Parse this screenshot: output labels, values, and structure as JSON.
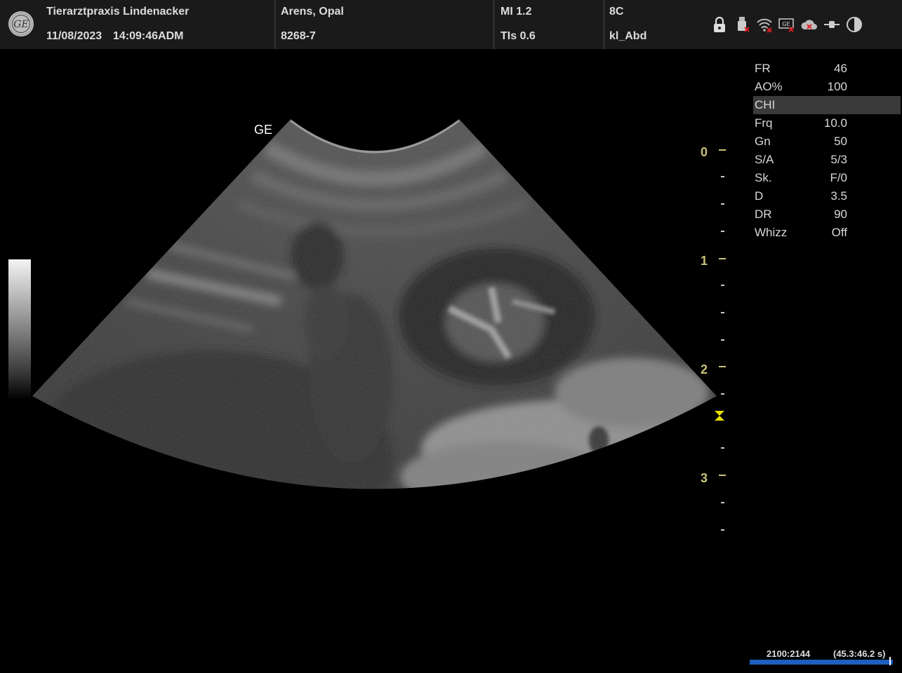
{
  "header": {
    "institution": "Tierarztpraxis Lindenacker",
    "date": "11/08/2023",
    "time": "14:09:46ADM",
    "patient_name": "Arens, Opal",
    "patient_id": "8268-7",
    "mi": "MI 1.2",
    "tis": "TIs 0.6",
    "probe": "8C",
    "preset": "kl_Abd",
    "status_icons": [
      "lock-icon",
      "usb-icon",
      "wifi-icon",
      "dicom-icon",
      "cloud-icon",
      "network-icon",
      "contrast-icon"
    ]
  },
  "image": {
    "probe_label": "GE"
  },
  "depth_scale": {
    "labels": [
      "0",
      "1",
      "2",
      "3"
    ],
    "unit_color": "#c8c27a"
  },
  "params": [
    {
      "label": "FR",
      "value": "46"
    },
    {
      "label": "AO%",
      "value": "100"
    },
    {
      "label": "CHI",
      "value": ""
    },
    {
      "label": "Frq",
      "value": "10.0"
    },
    {
      "label": "Gn",
      "value": "50"
    },
    {
      "label": "S/A",
      "value": "5/3"
    },
    {
      "label": "Sk.",
      "value": "F/0"
    },
    {
      "label": "D",
      "value": "3.5"
    },
    {
      "label": "DR",
      "value": "90"
    },
    {
      "label": "Whizz",
      "value": "Off"
    }
  ],
  "cine": {
    "frame_text": "2100:2144",
    "time_text": "(45.3:46.2 s)",
    "position": 0.979,
    "bar_color": "#1f5fbf"
  }
}
